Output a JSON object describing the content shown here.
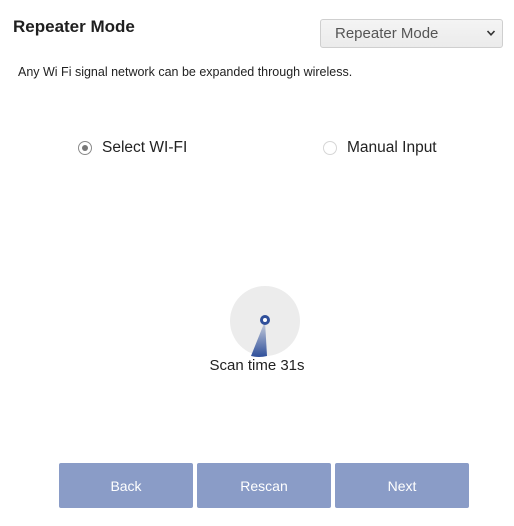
{
  "header": {
    "title": "Repeater Mode",
    "mode_select": {
      "selected": "Repeater Mode",
      "icon": "chevron-down-icon"
    }
  },
  "description": "Any Wi Fi signal network can be expanded through wireless.",
  "options": [
    {
      "label": "Select WI-FI",
      "checked": true
    },
    {
      "label": "Manual Input",
      "checked": false
    }
  ],
  "scan": {
    "icon": "radar-scan-icon",
    "text": "Scan time 31s"
  },
  "buttons": {
    "back": "Back",
    "rescan": "Rescan",
    "next": "Next"
  },
  "colors": {
    "button_bg": "#8a9cc7",
    "radar_circle": "#ececec",
    "radar_accent": "#2f4f9a"
  }
}
